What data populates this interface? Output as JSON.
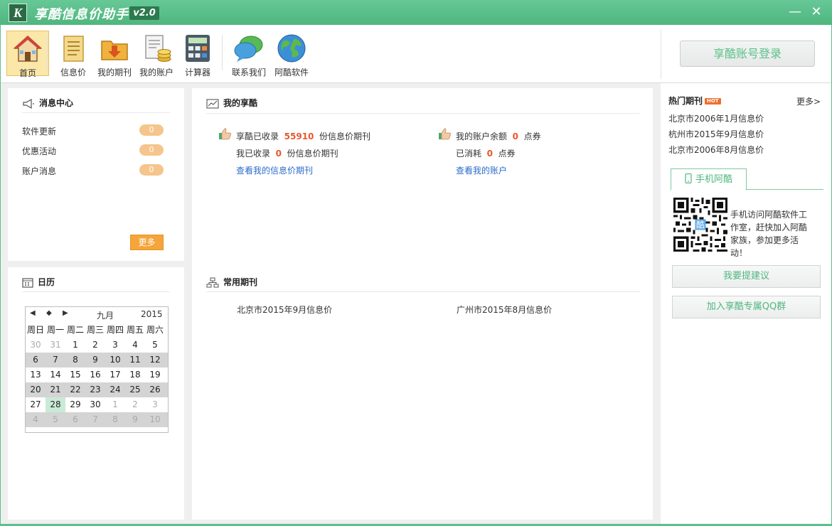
{
  "window": {
    "logo_letter": "K",
    "title": "享酷信息价助手",
    "version": "v2.0",
    "minimize": "—",
    "close": "✕"
  },
  "toolbar": {
    "items": [
      {
        "label": "首页",
        "icon": "home-icon"
      },
      {
        "label": "信息价",
        "icon": "document-icon"
      },
      {
        "label": "我的期刊",
        "icon": "download-folder-icon"
      },
      {
        "label": "我的账户",
        "icon": "account-coins-icon"
      },
      {
        "label": "计算器",
        "icon": "calculator-icon"
      },
      {
        "label": "联系我们",
        "icon": "chat-bubbles-icon"
      },
      {
        "label": "阿酷软件",
        "icon": "globe-icon"
      }
    ],
    "active_index": 0,
    "login_label": "享酷账号登录"
  },
  "messages": {
    "title": "消息中心",
    "rows": [
      {
        "label": "软件更新",
        "count": "0"
      },
      {
        "label": "优惠活动",
        "count": "0"
      },
      {
        "label": "账户消息",
        "count": "0"
      }
    ],
    "more_label": "更多"
  },
  "calendar": {
    "title": "日历",
    "prev": "◀",
    "today_marker": "◆",
    "next": "▶",
    "month": "九月",
    "year": "2015",
    "weekdays": [
      "周日",
      "周一",
      "周二",
      "周三",
      "周四",
      "周五",
      "周六"
    ],
    "weeks": [
      [
        "30",
        "31",
        "1",
        "2",
        "3",
        "4",
        "5"
      ],
      [
        "6",
        "7",
        "8",
        "9",
        "10",
        "11",
        "12"
      ],
      [
        "13",
        "14",
        "15",
        "16",
        "17",
        "18",
        "19"
      ],
      [
        "20",
        "21",
        "22",
        "23",
        "24",
        "25",
        "26"
      ],
      [
        "27",
        "28",
        "29",
        "30",
        "1",
        "2",
        "3"
      ],
      [
        "4",
        "5",
        "6",
        "7",
        "8",
        "9",
        "10"
      ]
    ],
    "today": "28"
  },
  "mine": {
    "title": "我的享酷",
    "left": {
      "line1_pre": "享酷已收录",
      "line1_num": "55910",
      "line1_post": "份信息价期刊",
      "line2_pre": "我已收录",
      "line2_num": "0",
      "line2_post": "份信息价期刊",
      "link": "查看我的信息价期刊"
    },
    "right": {
      "line1_pre": "我的账户余额",
      "line1_num": "0",
      "line1_post": "点券",
      "line2_pre": "已消耗",
      "line2_num": "0",
      "line2_post": "点券",
      "link": "查看我的账户"
    }
  },
  "common": {
    "title": "常用期刊",
    "items": [
      "北京市2015年9月信息价",
      "广州市2015年8月信息价"
    ]
  },
  "hot": {
    "title": "热门期刊",
    "badge": "HOT",
    "more": "更多>",
    "items": [
      "北京市2006年1月信息价",
      "杭州市2015年9月信息价",
      "北京市2006年8月信息价"
    ]
  },
  "mobile": {
    "tab_label": "手机阿酷",
    "qr_center": "酷",
    "text": "手机访问阿酷软件工作室，赶快加入阿酷家族，参加更多活动！"
  },
  "side_buttons": {
    "suggest": "我要提建议",
    "qq_group": "加入享酷专属QQ群"
  },
  "colors": {
    "brand": "#5cc08a",
    "accent_orange": "#f5a53a",
    "number_red": "#e8582b",
    "link_blue": "#2c6bc9"
  }
}
